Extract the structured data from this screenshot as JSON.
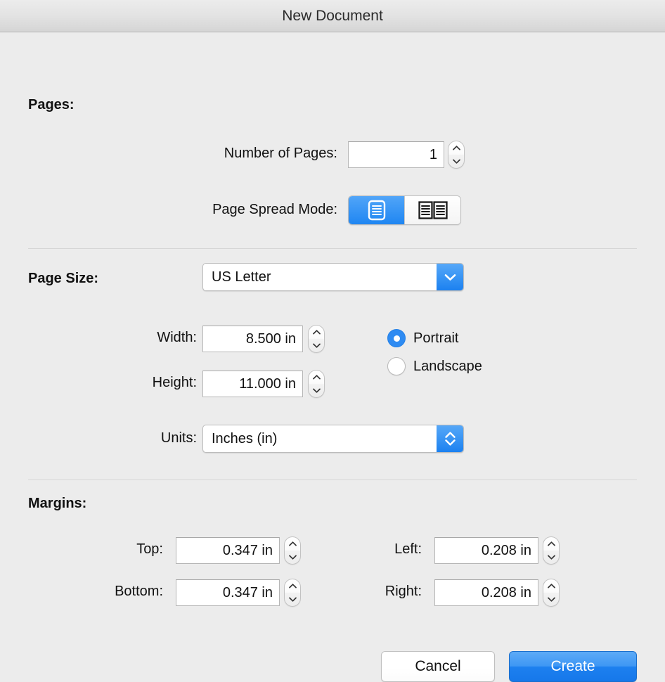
{
  "window": {
    "title": "New Document"
  },
  "sections": {
    "pages": {
      "title": "Pages:",
      "number_of_pages": {
        "label": "Number of Pages:",
        "value": "1"
      },
      "page_spread_mode": {
        "label": "Page Spread Mode:",
        "options": [
          "single-page-icon",
          "two-page-spread-icon"
        ],
        "selected_index": 0
      }
    },
    "page_size": {
      "title": "Page Size:",
      "preset": {
        "value": "US Letter"
      },
      "width": {
        "label": "Width:",
        "value": "8.500 in"
      },
      "height": {
        "label": "Height:",
        "value": "11.000 in"
      },
      "orientation": {
        "portrait_label": "Portrait",
        "landscape_label": "Landscape",
        "selected": "Portrait"
      },
      "units": {
        "label": "Units:",
        "value": "Inches (in)"
      }
    },
    "margins": {
      "title": "Margins:",
      "top": {
        "label": "Top:",
        "value": "0.347 in"
      },
      "bottom": {
        "label": "Bottom:",
        "value": "0.347 in"
      },
      "left": {
        "label": "Left:",
        "value": "0.208 in"
      },
      "right": {
        "label": "Right:",
        "value": "0.208 in"
      }
    }
  },
  "footer": {
    "cancel_label": "Cancel",
    "create_label": "Create"
  },
  "colors": {
    "accent_blue": "#2e8bf2",
    "window_background": "#ececec",
    "titlebar_top": "#ececec",
    "titlebar_bottom": "#d5d5d5",
    "separator": "#d6d6d6",
    "field_border": "#b6b6b6",
    "text": "#111111"
  }
}
